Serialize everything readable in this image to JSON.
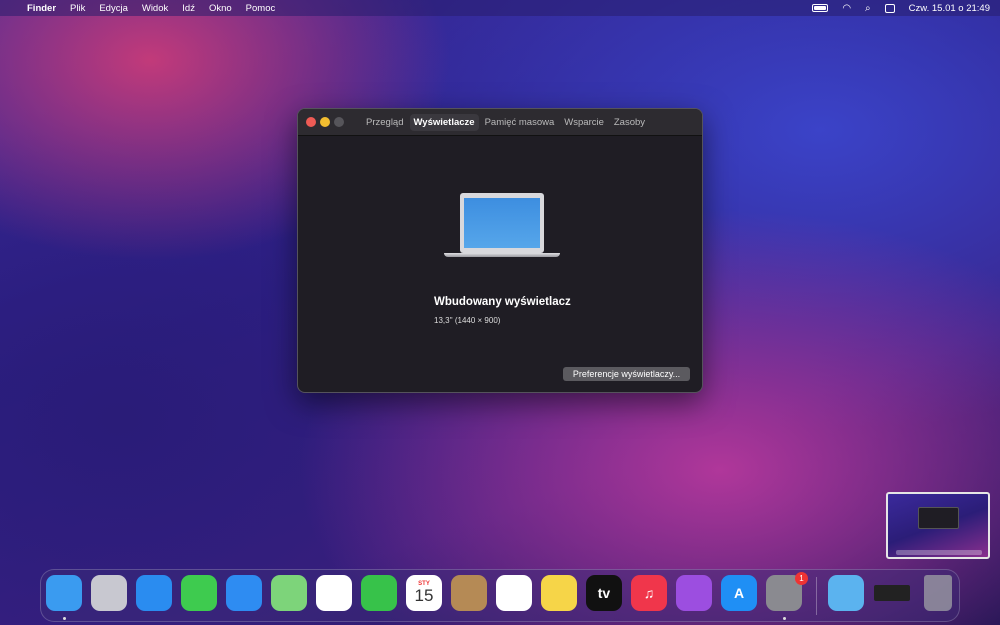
{
  "menubar": {
    "app": "Finder",
    "items": [
      "Plik",
      "Edycja",
      "Widok",
      "Idź",
      "Okno",
      "Pomoc"
    ],
    "clock": "Czw. 15.01 o 21:49"
  },
  "window": {
    "tabs": [
      "Przegląd",
      "Wyświetlacze",
      "Pamięć masowa",
      "Wsparcie",
      "Zasoby"
    ],
    "active_tab": 1,
    "display_name": "Wbudowany wyświetlacz",
    "display_spec": "13,3'' (1440 × 900)",
    "prefs_button": "Preferencje wyświetlaczy..."
  },
  "dock": {
    "apps": [
      {
        "name": "finder",
        "color": "#3a9bf0",
        "label": ""
      },
      {
        "name": "launchpad",
        "color": "#c8c8d0",
        "label": ""
      },
      {
        "name": "safari",
        "color": "#2a8cf0",
        "label": ""
      },
      {
        "name": "messages",
        "color": "#3ecb4f",
        "label": ""
      },
      {
        "name": "mail",
        "color": "#2e8cf2",
        "label": ""
      },
      {
        "name": "maps",
        "color": "#7dd47a",
        "label": ""
      },
      {
        "name": "photos",
        "color": "#ffffff",
        "label": ""
      },
      {
        "name": "facetime",
        "color": "#37c24a",
        "label": ""
      },
      {
        "name": "calendar",
        "color": "#ffffff",
        "label": "15",
        "month": "STY"
      },
      {
        "name": "contacts",
        "color": "#b58a55",
        "label": ""
      },
      {
        "name": "reminders",
        "color": "#ffffff",
        "label": ""
      },
      {
        "name": "notes",
        "color": "#f6d548",
        "label": ""
      },
      {
        "name": "tv",
        "color": "#111111",
        "label": "tv"
      },
      {
        "name": "music",
        "color": "#f0364b",
        "label": "♫"
      },
      {
        "name": "podcasts",
        "color": "#9c4ee0",
        "label": ""
      },
      {
        "name": "app-store",
        "color": "#1f8ff5",
        "label": "A"
      },
      {
        "name": "system-preferences",
        "color": "#8a8a90",
        "label": "",
        "badge": "1"
      }
    ],
    "right": [
      {
        "name": "downloads",
        "color": "#5bb3ef"
      },
      {
        "name": "system-info-window",
        "color": "#222"
      },
      {
        "name": "trash",
        "color": "#9a9aa2"
      }
    ]
  }
}
